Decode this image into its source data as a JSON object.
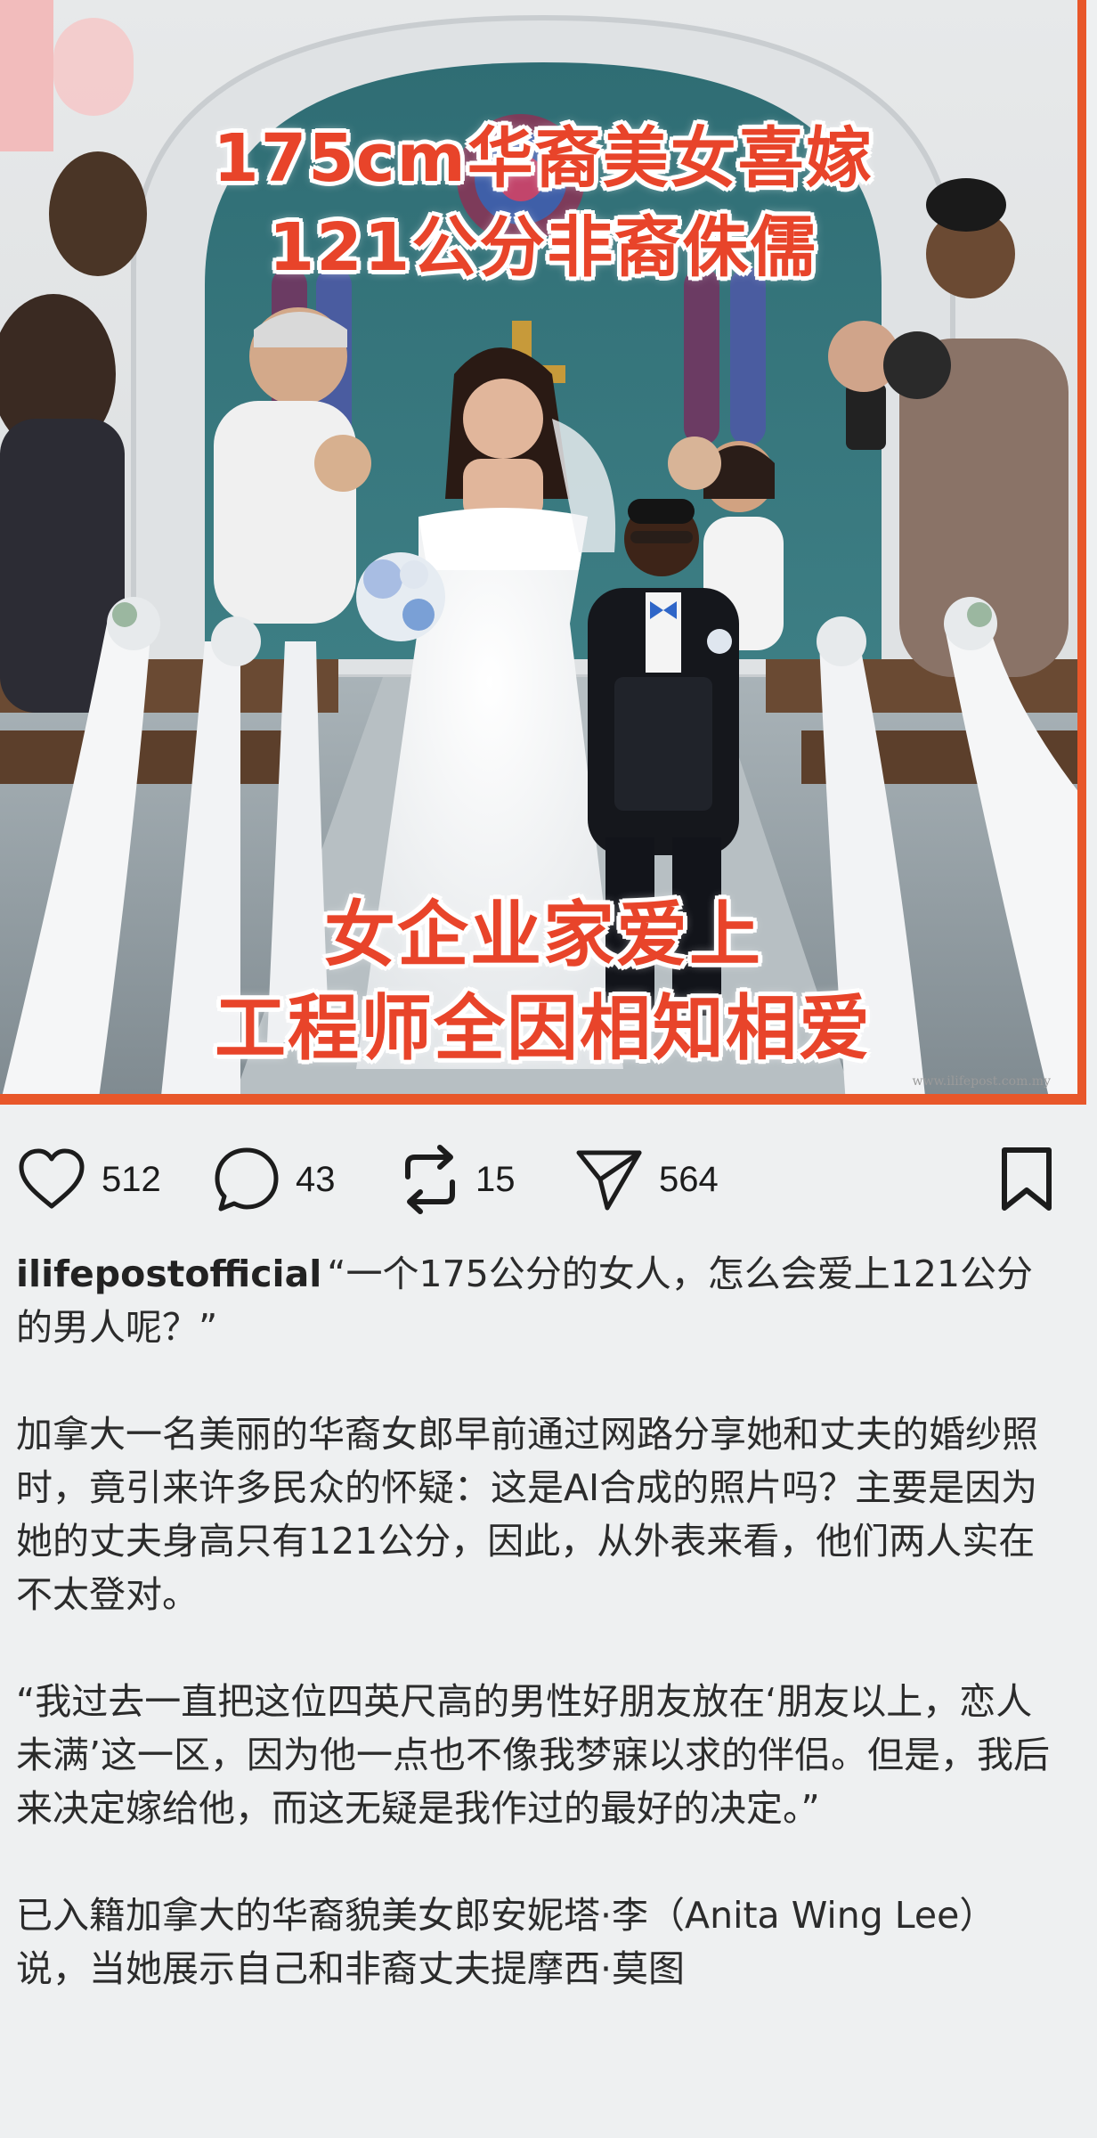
{
  "photo": {
    "headline_top": [
      "175cm华裔美女喜嫁",
      "121公分非裔侏儒"
    ],
    "headline_bottom": [
      "女企业家爱上",
      "工程师全因相知相爱"
    ],
    "watermark": "www.ilifepost.com.my",
    "frame_color": "#e8572a",
    "headline_color": "#e8442a"
  },
  "actions": {
    "like_icon": "heart-icon",
    "like_count": "512",
    "comment_icon": "comment-bubble-icon",
    "comment_count": "43",
    "repost_icon": "repost-icon",
    "repost_count": "15",
    "share_icon": "send-icon",
    "share_count": "564",
    "save_icon": "bookmark-icon"
  },
  "caption": {
    "username": "ilifepostofficial",
    "quote": "“一个175公分的女人，怎么会爱上121公分的男人呢？”",
    "paragraph1": "加拿大一名美丽的华裔女郎早前通过网路分享她和丈夫的婚纱照时，竟引来许多民众的怀疑：这是AI合成的照片吗？主要是因为她的丈夫身高只有121公分，因此，从外表来看，他们两人实在不太登对。",
    "paragraph2": "“我过去一直把这位四英尺高的男性好朋友放在‘朋友以上，恋人未满’这一区，因为他一点也不像我梦寐以求的伴侣。但是，我后来决定嫁给他，而这无疑是我作过的最好的决定。”",
    "paragraph3": "已入籍加拿大的华裔貌美女郎安妮塔·李（Anita Wing Lee）说，当她展示自己和非裔丈夫提摩西·莫图"
  }
}
